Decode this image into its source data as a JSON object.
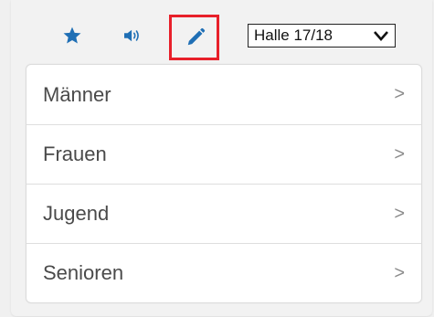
{
  "toolbar": {
    "icons": {
      "favorite": "star-icon",
      "sound": "speaker-icon",
      "edit": "pencil-icon"
    },
    "highlight_color": "#e8202a",
    "icon_color": "#1f6fb5",
    "season_select": {
      "value": "Halle 17/18"
    }
  },
  "menu": {
    "items": [
      {
        "label": "Männer",
        "chevron": ">"
      },
      {
        "label": "Frauen",
        "chevron": ">"
      },
      {
        "label": "Jugend",
        "chevron": ">"
      },
      {
        "label": "Senioren",
        "chevron": ">"
      }
    ]
  }
}
